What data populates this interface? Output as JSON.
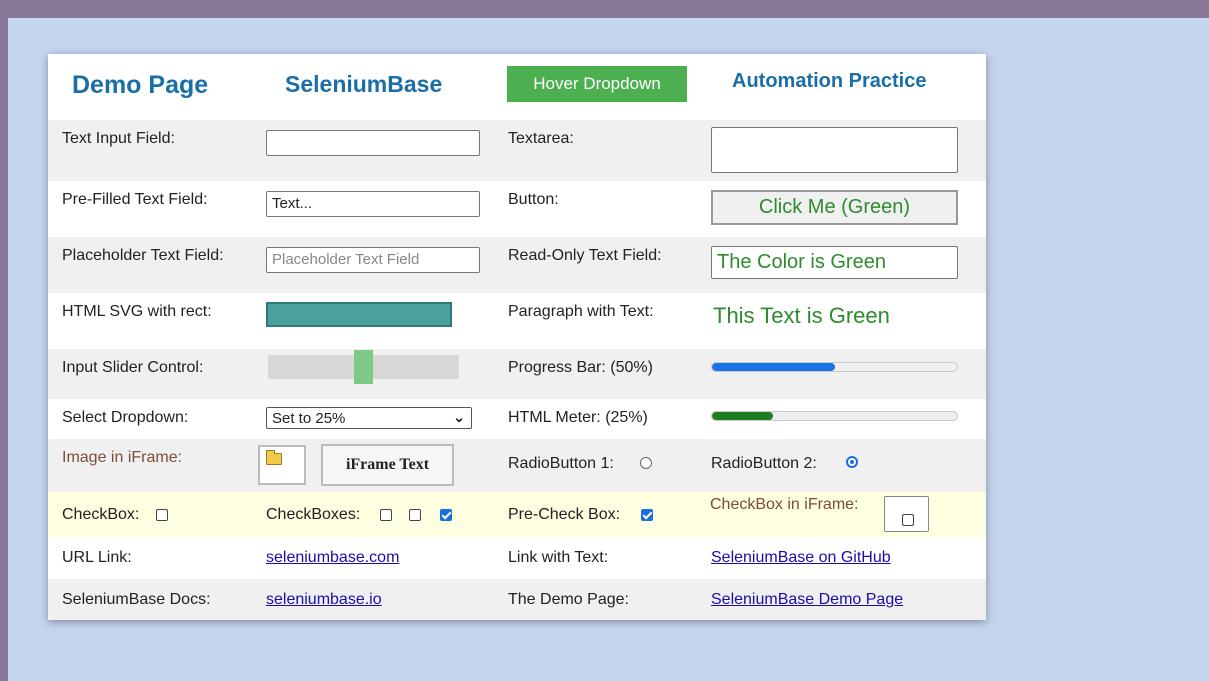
{
  "header": {
    "demo_page": "Demo Page",
    "seleniumbase": "SeleniumBase",
    "hover_dropdown": "Hover Dropdown",
    "automation_practice": "Automation Practice"
  },
  "rows": {
    "text_input_label": "Text Input Field:",
    "text_input_value": "",
    "textarea_label": "Textarea:",
    "textarea_value": "",
    "prefilled_label": "Pre-Filled Text Field:",
    "prefilled_value": "Text...",
    "button_label": "Button:",
    "button_text": "Click Me (Green)",
    "placeholder_label": "Placeholder Text Field:",
    "placeholder_text": "Placeholder Text Field",
    "readonly_label": "Read-Only Text Field:",
    "readonly_value": "The Color is Green",
    "svg_label": "HTML SVG with rect:",
    "paragraph_label": "Paragraph with Text:",
    "paragraph_text": "This Text is Green",
    "slider_label": "Input Slider Control:",
    "slider_value_fraction": 0.5,
    "progress_label": "Progress Bar: (50%)",
    "progress_value_fraction": 0.5,
    "select_label": "Select Dropdown:",
    "select_value": "Set to 25%",
    "meter_label": "HTML Meter: (25%)",
    "meter_value_fraction": 0.25,
    "image_iframe_label": "Image in iFrame:",
    "iframe_text": "iFrame Text",
    "radio1_label": "RadioButton 1:",
    "radio2_label": "RadioButton 2:",
    "checkbox_label": "CheckBox:",
    "checkboxes_label": "CheckBoxes:",
    "precheck_label": "Pre-Check Box:",
    "checkbox_iframe_label": "CheckBox in iFrame:",
    "url_link_label": "URL Link:",
    "url_link": "seleniumbase.com",
    "link_text_label": "Link with Text:",
    "link_text": "SeleniumBase on GitHub",
    "docs_label": "SeleniumBase Docs:",
    "docs_link": "seleniumbase.io",
    "demo_page_label": "The Demo Page:",
    "demo_page_link": "SeleniumBase Demo Page"
  },
  "colors": {
    "page_background": "#c5d5ee",
    "top_bar": "#8a7899",
    "accent_green": "#4caf50",
    "title_blue": "#1a6fa8",
    "progress_blue": "#1a73e8",
    "meter_green": "#1e7e1e"
  },
  "icons": {
    "iframe_image": "folder-icon"
  }
}
